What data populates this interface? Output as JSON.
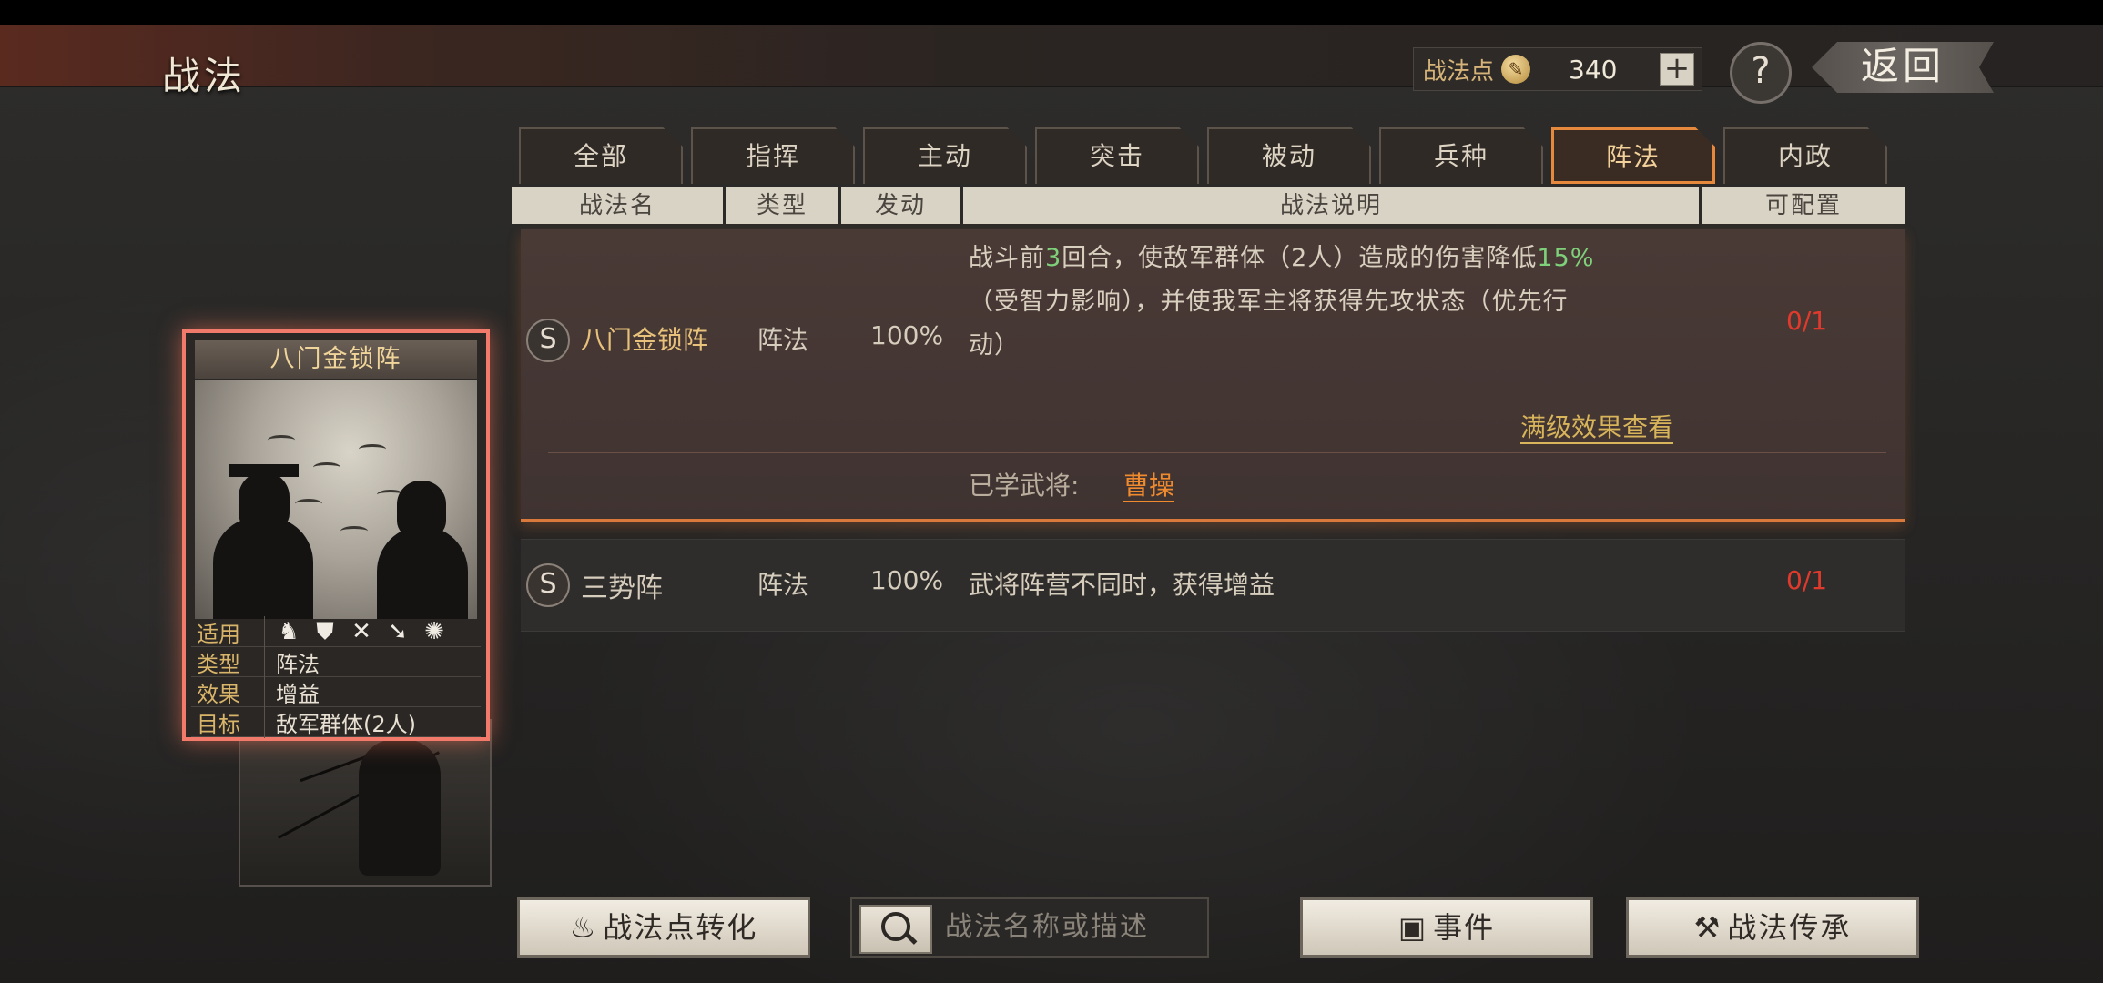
{
  "header": {
    "title": "战法",
    "points_label": "战法点",
    "points_value": "340",
    "plus_label": "+",
    "help_label": "?",
    "back_label": "返回"
  },
  "tabs": [
    {
      "label": "全部",
      "active": false
    },
    {
      "label": "指挥",
      "active": false
    },
    {
      "label": "主动",
      "active": false
    },
    {
      "label": "突击",
      "active": false
    },
    {
      "label": "被动",
      "active": false
    },
    {
      "label": "兵种",
      "active": false
    },
    {
      "label": "阵法",
      "active": true
    },
    {
      "label": "内政",
      "active": false
    }
  ],
  "columns": {
    "name": "战法名",
    "type": "类型",
    "trigger": "发动",
    "desc": "战法说明",
    "config": "可配置"
  },
  "tactics": [
    {
      "grade": "S",
      "name": "八门金锁阵",
      "type": "阵法",
      "trigger": "100%",
      "desc_part1": "战斗前",
      "desc_num1": "3",
      "desc_part2": "回合，使敌军群体（2人）造成的伤害降低",
      "desc_num2": "15%",
      "desc_line2": "（受智力影响），并使我军主将获得先攻状态（优先行",
      "desc_line3": "动）",
      "config": "0/1",
      "full_effect_link": "满级效果查看",
      "learned_label": "已学武将:",
      "learned_general": "曹操"
    },
    {
      "grade": "S",
      "name": "三势阵",
      "type": "阵法",
      "trigger": "100%",
      "desc": "武将阵营不同时，获得增益",
      "config": "0/1"
    }
  ],
  "card": {
    "title": "八门金锁阵",
    "applicable_label": "适用",
    "applicable_icons": [
      "cavalry-icon",
      "shield-icon",
      "archer-icon",
      "spear-icon",
      "chariot-icon"
    ],
    "type_label": "类型",
    "type_value": "阵法",
    "effect_label": "效果",
    "effect_value": "增益",
    "target_label": "目标",
    "target_value": "敌军群体(2人)"
  },
  "bottom": {
    "convert_button": "战法点转化",
    "search_placeholder": "战法名称或描述",
    "event_button": "事件",
    "inherit_button": "战法传承"
  },
  "colors": {
    "accent_orange": "#e7893c",
    "highlight_green": "#7fd07a",
    "config_red": "#e03a2c",
    "card_border": "#f27a6a"
  }
}
